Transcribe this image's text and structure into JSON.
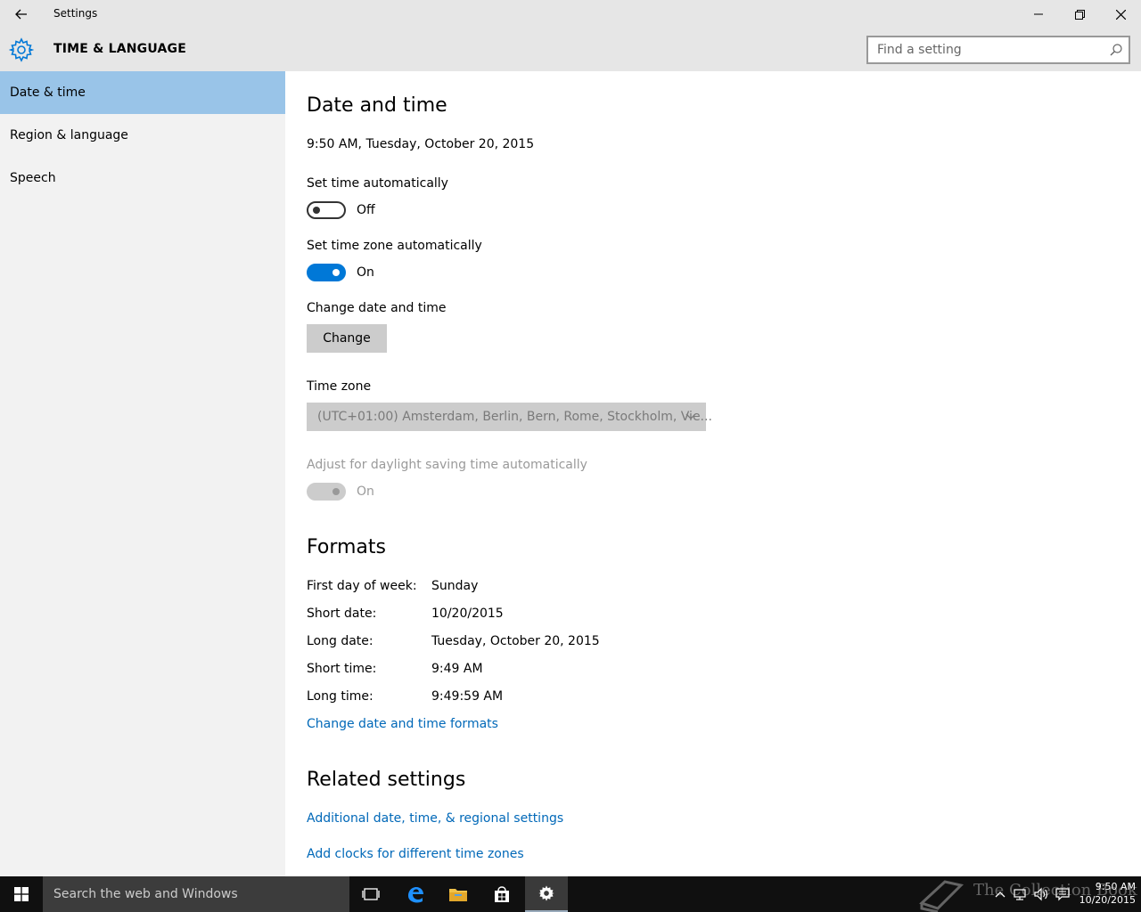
{
  "window": {
    "title": "Settings"
  },
  "header": {
    "section_title": "TIME & LANGUAGE",
    "search_placeholder": "Find a setting"
  },
  "sidebar": {
    "items": [
      {
        "label": "Date & time",
        "active": true
      },
      {
        "label": "Region & language",
        "active": false
      },
      {
        "label": "Speech",
        "active": false
      }
    ]
  },
  "main": {
    "heading": "Date and time",
    "current_datetime": "9:50 AM, Tuesday, October 20, 2015",
    "set_time_auto": {
      "label": "Set time automatically",
      "state": "Off"
    },
    "set_timezone_auto": {
      "label": "Set time zone automatically",
      "state": "On"
    },
    "change_datetime": {
      "label": "Change date and time",
      "button": "Change"
    },
    "timezone": {
      "label": "Time zone",
      "value": "(UTC+01:00) Amsterdam, Berlin, Bern, Rome, Stockholm, Vie..."
    },
    "daylight": {
      "label": "Adjust for daylight saving time automatically",
      "state": "On"
    },
    "formats": {
      "heading": "Formats",
      "rows": [
        {
          "label": "First day of week:",
          "value": "Sunday"
        },
        {
          "label": "Short date:",
          "value": "10/20/2015"
        },
        {
          "label": "Long date:",
          "value": "Tuesday, October 20, 2015"
        },
        {
          "label": "Short time:",
          "value": "9:49 AM"
        },
        {
          "label": "Long time:",
          "value": "9:49:59 AM"
        }
      ],
      "link": "Change date and time formats"
    },
    "related": {
      "heading": "Related settings",
      "links": [
        "Additional date, time, & regional settings",
        "Add clocks for different time zones"
      ]
    }
  },
  "taskbar": {
    "search_placeholder": "Search the web and Windows",
    "clock_time": "9:50 AM",
    "clock_date": "10/20/2015",
    "watermark": "The Collection Book"
  },
  "colors": {
    "accent": "#0078d7",
    "nav_active": "#99c4e8",
    "link": "#0068b8"
  }
}
